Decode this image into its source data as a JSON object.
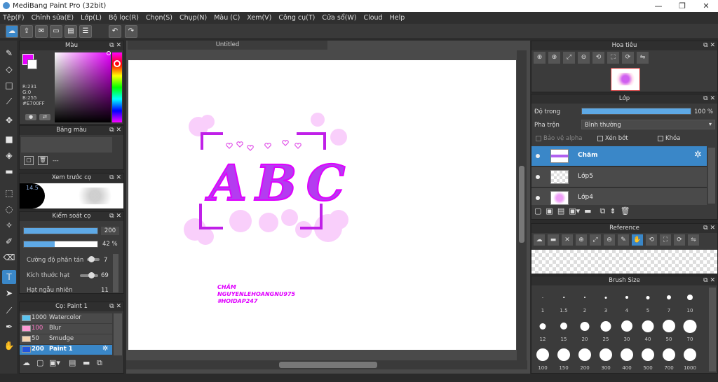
{
  "window": {
    "title": "MediBang Paint Pro (32bit)",
    "minimize": "—",
    "maximize": "❐",
    "close": "✕"
  },
  "menu": [
    "Tệp(F)",
    "Chỉnh sửa(E)",
    "Lớp(L)",
    "Bộ lọc(R)",
    "Chọn(S)",
    "Chụp(N)",
    "Màu (C)",
    "Xem(V)",
    "Công cụ(T)",
    "Cửa sổ(W)",
    "Cloud",
    "Help"
  ],
  "color_panel": {
    "title": "Màu",
    "r": "R:231",
    "g": "G:0",
    "b": "B:255",
    "hex": "#E700FF",
    "primary_color": "#e700ff"
  },
  "palette_panel": {
    "title": "Bảng màu",
    "empty": "---"
  },
  "brush_preview": {
    "title": "Xem trước cọ",
    "value": "14.5"
  },
  "brush_control": {
    "title": "Kiểm soát cọ",
    "size_value": "200",
    "opacity_value": "42 %",
    "opacity_fraction": 0.42,
    "params": [
      {
        "label": "Cường độ phân tán",
        "value": "7"
      },
      {
        "label": "Kích thước hạt",
        "value": "69"
      },
      {
        "label": "Hạt ngẫu nhiên",
        "value": "11"
      }
    ]
  },
  "brush_list": {
    "title": "Cọ: Paint 1",
    "items": [
      {
        "size": "1000",
        "name": "Watercolor",
        "color": "#5bc4f0"
      },
      {
        "size": "100",
        "name": "Blur",
        "color": "#ff9ad5"
      },
      {
        "size": "50",
        "name": "Smudge",
        "color": "#f4d3b0"
      },
      {
        "size": "200",
        "name": "Paint 1",
        "color": "#2255dd"
      }
    ]
  },
  "canvas": {
    "tab": "Untitled",
    "art_letters": "ABC",
    "credit_lines": [
      "CHĂM",
      "NGUYENLEHOANGNU975",
      "#HOIDAP247"
    ]
  },
  "navigator": {
    "title": "Hoa tiêu"
  },
  "layers": {
    "title": "Lớp",
    "opacity_label": "Độ trong",
    "opacity_value": "100 %",
    "opacity_fraction": 1.0,
    "blend_label": "Pha trộn",
    "blend_value": "Bình thường",
    "protect_alpha": "Bảo vệ alpha",
    "clipping": "Xén bớt",
    "lock": "Khóa",
    "items": [
      "Chăm",
      "Lớp5",
      "Lớp4"
    ]
  },
  "reference": {
    "title": "Reference"
  },
  "brush_size": {
    "title": "Brush Size",
    "sizes": [
      "1",
      "1.5",
      "2",
      "3",
      "4",
      "5",
      "7",
      "10",
      "12",
      "15",
      "20",
      "25",
      "30",
      "40",
      "50",
      "70",
      "100",
      "150",
      "200",
      "300",
      "400",
      "500",
      "700",
      "1000"
    ]
  }
}
